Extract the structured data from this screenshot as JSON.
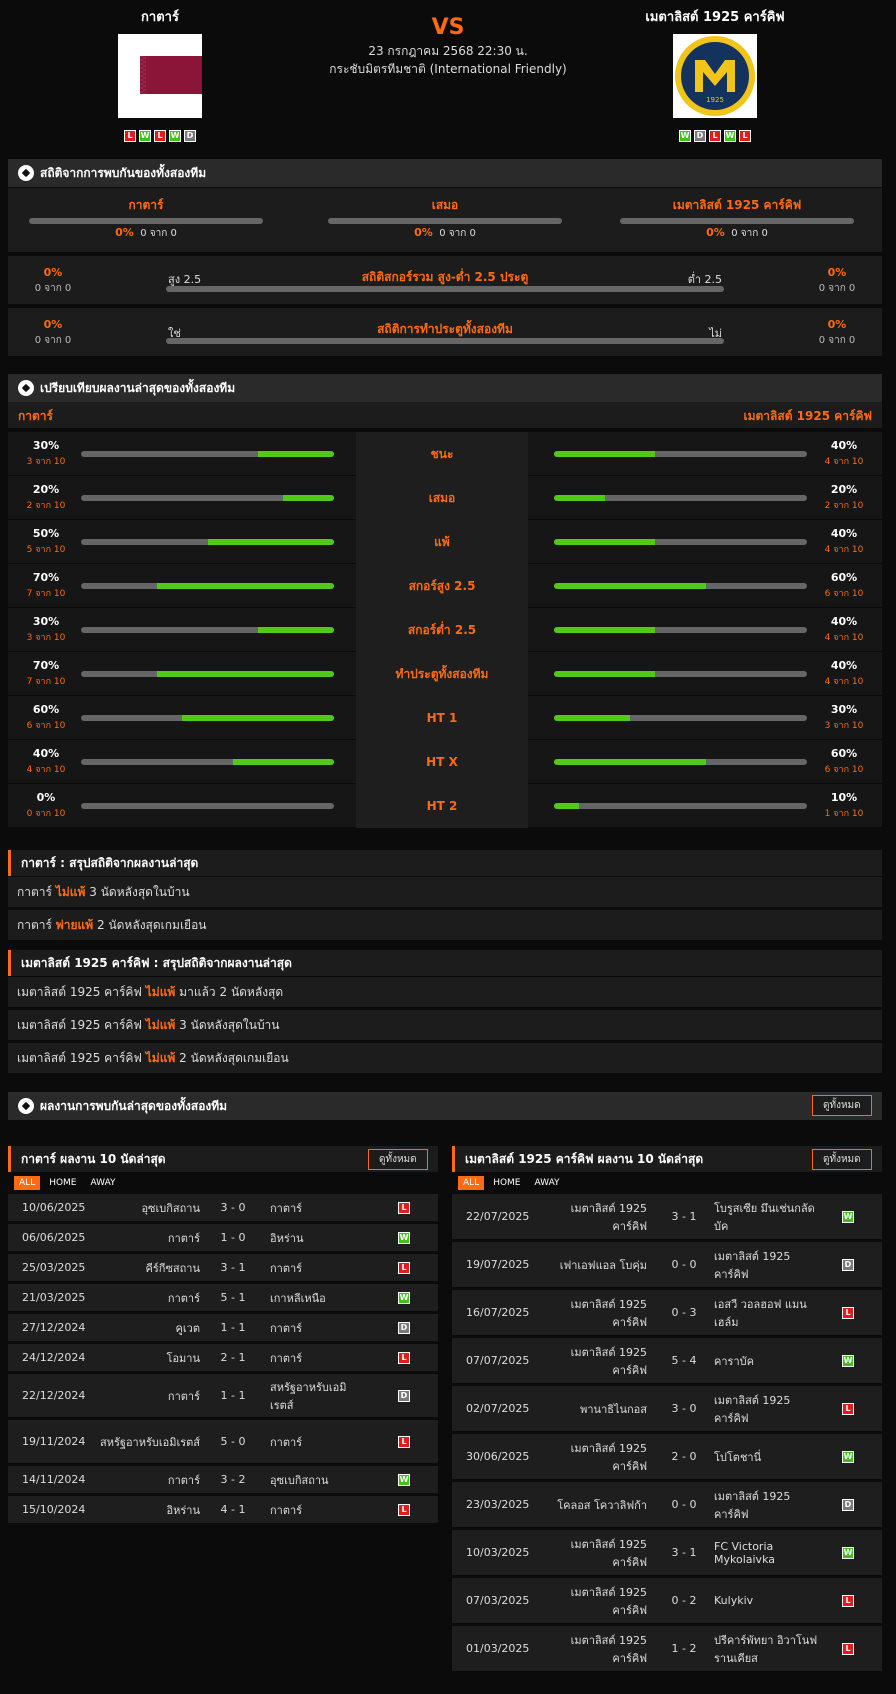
{
  "header": {
    "home_name": "กาตาร์",
    "away_name": "เมตาลิสต์ 1925 คาร์คิฟ",
    "vs": "VS",
    "date": "23 กรกฎาคม 2568 22:30 น.",
    "competition": "กระชับมิตรทีมชาติ (International Friendly)",
    "home_form": [
      "L",
      "W",
      "L",
      "W",
      "D"
    ],
    "away_form": [
      "W",
      "D",
      "L",
      "W",
      "L"
    ],
    "away_logo_year": "1925"
  },
  "h2h": {
    "title": "สถิติจากการพบกันของทั้งสองทีม",
    "cols": [
      {
        "label": "กาตาร์",
        "pct": "0%",
        "count": "0 จาก 0"
      },
      {
        "label": "เสมอ",
        "pct": "0%",
        "count": "0 จาก 0"
      },
      {
        "label": "เมตาลิสต์ 1925 คาร์คิฟ",
        "pct": "0%",
        "count": "0 จาก 0"
      }
    ],
    "ou": {
      "title": "สถิติสกอร์รวม สูง-ต่ำ 2.5 ประตู",
      "left_label": "สูง 2.5",
      "right_label": "ต่ำ 2.5",
      "left_pct": "0%",
      "left_count": "0 จาก 0",
      "right_pct": "0%",
      "right_count": "0 จาก 0"
    },
    "btts": {
      "title": "สถิติการทำประตูทั้งสองทีม",
      "left_label": "ใช่",
      "right_label": "ไม่",
      "left_pct": "0%",
      "left_count": "0 จาก 0",
      "right_pct": "0%",
      "right_count": "0 จาก 0"
    }
  },
  "compare": {
    "title": "เปรียบเทียบผลงานล่าสุดของทั้งสองทีม",
    "home": "กาตาร์",
    "away": "เมตาลิสต์ 1925 คาร์คิฟ",
    "rows": [
      {
        "label": "ชนะ",
        "hp": "30%",
        "hc": "3 จาก 10",
        "hv": 30,
        "ap": "40%",
        "ac": "4 จาก 10",
        "av": 40
      },
      {
        "label": "เสมอ",
        "hp": "20%",
        "hc": "2 จาก 10",
        "hv": 20,
        "ap": "20%",
        "ac": "2 จาก 10",
        "av": 20
      },
      {
        "label": "แพ้",
        "hp": "50%",
        "hc": "5 จาก 10",
        "hv": 50,
        "ap": "40%",
        "ac": "4 จาก 10",
        "av": 40
      },
      {
        "label": "สกอร์สูง 2.5",
        "hp": "70%",
        "hc": "7 จาก 10",
        "hv": 70,
        "ap": "60%",
        "ac": "6 จาก 10",
        "av": 60
      },
      {
        "label": "สกอร์ต่ำ 2.5",
        "hp": "30%",
        "hc": "3 จาก 10",
        "hv": 30,
        "ap": "40%",
        "ac": "4 จาก 10",
        "av": 40
      },
      {
        "label": "ทำประตูทั้งสองทีม",
        "hp": "70%",
        "hc": "7 จาก 10",
        "hv": 70,
        "ap": "40%",
        "ac": "4 จาก 10",
        "av": 40
      },
      {
        "label": "HT 1",
        "hp": "60%",
        "hc": "6 จาก 10",
        "hv": 60,
        "ap": "30%",
        "ac": "3 จาก 10",
        "av": 30
      },
      {
        "label": "HT X",
        "hp": "40%",
        "hc": "4 จาก 10",
        "hv": 40,
        "ap": "60%",
        "ac": "6 จาก 10",
        "av": 60
      },
      {
        "label": "HT 2",
        "hp": "0%",
        "hc": "0 จาก 10",
        "hv": 0,
        "ap": "10%",
        "ac": "1 จาก 10",
        "av": 10
      }
    ]
  },
  "summary_home": {
    "title": "กาตาร์ : สรุปสถิติจากผลงานล่าสุด",
    "lines": [
      {
        "team": "กาตาร์",
        "hl": "ไม่แพ้",
        "num": "3",
        "rest": "นัดหลังสุดในบ้าน"
      },
      {
        "team": "กาตาร์",
        "hl": "พ่ายแพ้",
        "num": "2",
        "rest": "นัดหลังสุดเกมเยือน"
      }
    ]
  },
  "summary_away": {
    "title": "เมตาลิสต์ 1925 คาร์คิฟ : สรุปสถิติจากผลงานล่าสุด",
    "lines": [
      {
        "team": "เมตาลิสต์ 1925 คาร์คิฟ",
        "hl": "ไม่แพ้",
        "num": "มาแล้ว 2",
        "rest": "นัดหลังสุด"
      },
      {
        "team": "เมตาลิสต์ 1925 คาร์คิฟ",
        "hl": "ไม่แพ้",
        "num": "3",
        "rest": "นัดหลังสุดในบ้าน"
      },
      {
        "team": "เมตาลิสต์ 1925 คาร์คิฟ",
        "hl": "ไม่แพ้",
        "num": "2",
        "rest": "นัดหลังสุดเกมเยือน"
      }
    ]
  },
  "recent": {
    "title": "ผลงานการพบกันล่าสุดของทั้งสองทีม",
    "view_all": "ดูทั้งหมด",
    "tabs": [
      "ALL",
      "HOME",
      "AWAY"
    ],
    "home_title": "กาตาร์ ผลงาน 10 นัดล่าสุด",
    "away_title": "เมตาลิสต์ 1925 คาร์คิฟ ผลงาน 10 นัดล่าสุด",
    "home_matches": [
      {
        "date": "10/06/2025",
        "home": "อุซเบกิสถาน",
        "score": "3 - 0",
        "away": "กาตาร์",
        "res": "L"
      },
      {
        "date": "06/06/2025",
        "home": "กาตาร์",
        "score": "1 - 0",
        "away": "อิหร่าน",
        "res": "W"
      },
      {
        "date": "25/03/2025",
        "home": "คีร์กีซสถาน",
        "score": "3 - 1",
        "away": "กาตาร์",
        "res": "L"
      },
      {
        "date": "21/03/2025",
        "home": "กาตาร์",
        "score": "5 - 1",
        "away": "เกาหลีเหนือ",
        "res": "W"
      },
      {
        "date": "27/12/2024",
        "home": "คูเวต",
        "score": "1 - 1",
        "away": "กาตาร์",
        "res": "D"
      },
      {
        "date": "24/12/2024",
        "home": "โอมาน",
        "score": "2 - 1",
        "away": "กาตาร์",
        "res": "L"
      },
      {
        "date": "22/12/2024",
        "home": "กาตาร์",
        "score": "1 - 1",
        "away": "สหรัฐอาหรับเอมิเรตส์",
        "res": "D"
      },
      {
        "date": "19/11/2024",
        "home": "สหรัฐอาหรับเอมิเรตส์",
        "score": "5 - 0",
        "away": "กาตาร์",
        "res": "L"
      },
      {
        "date": "14/11/2024",
        "home": "กาตาร์",
        "score": "3 - 2",
        "away": "อุซเบกิสถาน",
        "res": "W"
      },
      {
        "date": "15/10/2024",
        "home": "อิหร่าน",
        "score": "4 - 1",
        "away": "กาตาร์",
        "res": "L"
      }
    ],
    "away_matches": [
      {
        "date": "22/07/2025",
        "home": "เมตาลิสต์ 1925 คาร์คิฟ",
        "score": "3 - 1",
        "away": "โบรูสเซีย มึนเช่นกลัดบัค",
        "res": "W"
      },
      {
        "date": "19/07/2025",
        "home": "เฟาเอฟแอล โบคุ่ม",
        "score": "0 - 0",
        "away": "เมตาลิสต์ 1925 คาร์คิฟ",
        "res": "D"
      },
      {
        "date": "16/07/2025",
        "home": "เมตาลิสต์ 1925 คาร์คิฟ",
        "score": "0 - 3",
        "away": "เอสวี วอลฮอฟ แมนเฮล์ม",
        "res": "L"
      },
      {
        "date": "07/07/2025",
        "home": "เมตาลิสต์ 1925 คาร์คิฟ",
        "score": "5 - 4",
        "away": "คาราบัค",
        "res": "W"
      },
      {
        "date": "02/07/2025",
        "home": "พานาธิไนกอส",
        "score": "3 - 0",
        "away": "เมตาลิสต์ 1925 คาร์คิฟ",
        "res": "L"
      },
      {
        "date": "30/06/2025",
        "home": "เมตาลิสต์ 1925 คาร์คิฟ",
        "score": "2 - 0",
        "away": "โปโตชานี่",
        "res": "W"
      },
      {
        "date": "23/03/2025",
        "home": "โคลอส โควาลิฟก้า",
        "score": "0 - 0",
        "away": "เมตาลิสต์ 1925 คาร์คิฟ",
        "res": "D"
      },
      {
        "date": "10/03/2025",
        "home": "เมตาลิสต์ 1925 คาร์คิฟ",
        "score": "3 - 1",
        "away": "FC Victoria Mykolaivka",
        "res": "W"
      },
      {
        "date": "07/03/2025",
        "home": "เมตาลิสต์ 1925 คาร์คิฟ",
        "score": "0 - 2",
        "away": "Kulykiv",
        "res": "L"
      },
      {
        "date": "01/03/2025",
        "home": "เมตาลิสต์ 1925 คาร์คิฟ",
        "score": "1 - 2",
        "away": "ปรีคาร์พัทยา อิวาโนฟรานเคียส",
        "res": "L"
      }
    ]
  },
  "colors": {
    "accent": "#ff6a13",
    "win": "#3fc21a",
    "loss": "#e21b1b",
    "draw": "#7a7a7a",
    "bar": "#51c917"
  }
}
